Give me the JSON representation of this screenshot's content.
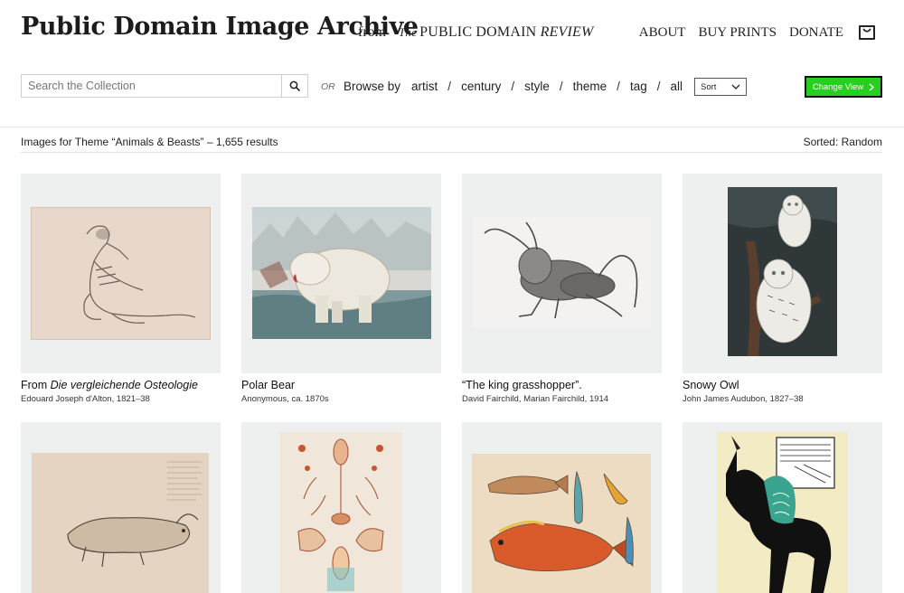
{
  "header": {
    "site_title": "Public Domain Image Archive",
    "from_label": "from",
    "logo": {
      "the": "The",
      "main": "PUBLIC DOMAIN",
      "review": "REVIEW"
    },
    "nav": [
      "ABOUT",
      "BUY PRINTS",
      "DONATE"
    ],
    "cart_icon": "shopping-bag-icon"
  },
  "search": {
    "placeholder": "Search the Collection",
    "value": "",
    "button_icon": "search-icon"
  },
  "browse": {
    "or_label": "OR",
    "label": "Browse by",
    "links": [
      "artist",
      "century",
      "style",
      "theme",
      "tag",
      "all"
    ]
  },
  "sort": {
    "selected": "Sort",
    "icon": "chevron-down-icon"
  },
  "change_view": {
    "label": "Change View",
    "icon": "chevron-right-icon",
    "accent": "#25d11e"
  },
  "results": {
    "title": "Images for Theme “Animals & Beasts” – 1,655 results",
    "sorted": "Sorted: Random"
  },
  "items": [
    {
      "title_prefix": "From ",
      "title_italic": "Die vergleichende Osteologie",
      "title": "",
      "credit": "Edouard Joseph d'Alton, 1821–38",
      "image": "skeleton-anatomy-plate"
    },
    {
      "title_prefix": "",
      "title_italic": "",
      "title": "Polar Bear",
      "credit": "Anonymous, ca. 1870s",
      "image": "polar-bear-illustration"
    },
    {
      "title_prefix": "",
      "title_italic": "",
      "title": "“The king grasshopper”.",
      "credit": "David Fairchild, Marian Fairchild, 1914",
      "image": "grasshopper-photograph"
    },
    {
      "title_prefix": "",
      "title_italic": "",
      "title": "Snowy Owl",
      "credit": "John James Audubon, 1827–38",
      "image": "snowy-owl-illustration"
    },
    {
      "title_prefix": "",
      "title_italic": "",
      "title": "",
      "credit": "",
      "image": "sea-creature-engraving"
    },
    {
      "title_prefix": "",
      "title_italic": "",
      "title": "",
      "credit": "",
      "image": "plankton-specimen-plate"
    },
    {
      "title_prefix": "",
      "title_italic": "",
      "title": "",
      "credit": "",
      "image": "tropical-fish-plate"
    },
    {
      "title_prefix": "",
      "title_italic": "",
      "title": "",
      "credit": "",
      "image": "unicorn-knight-illustration"
    }
  ]
}
